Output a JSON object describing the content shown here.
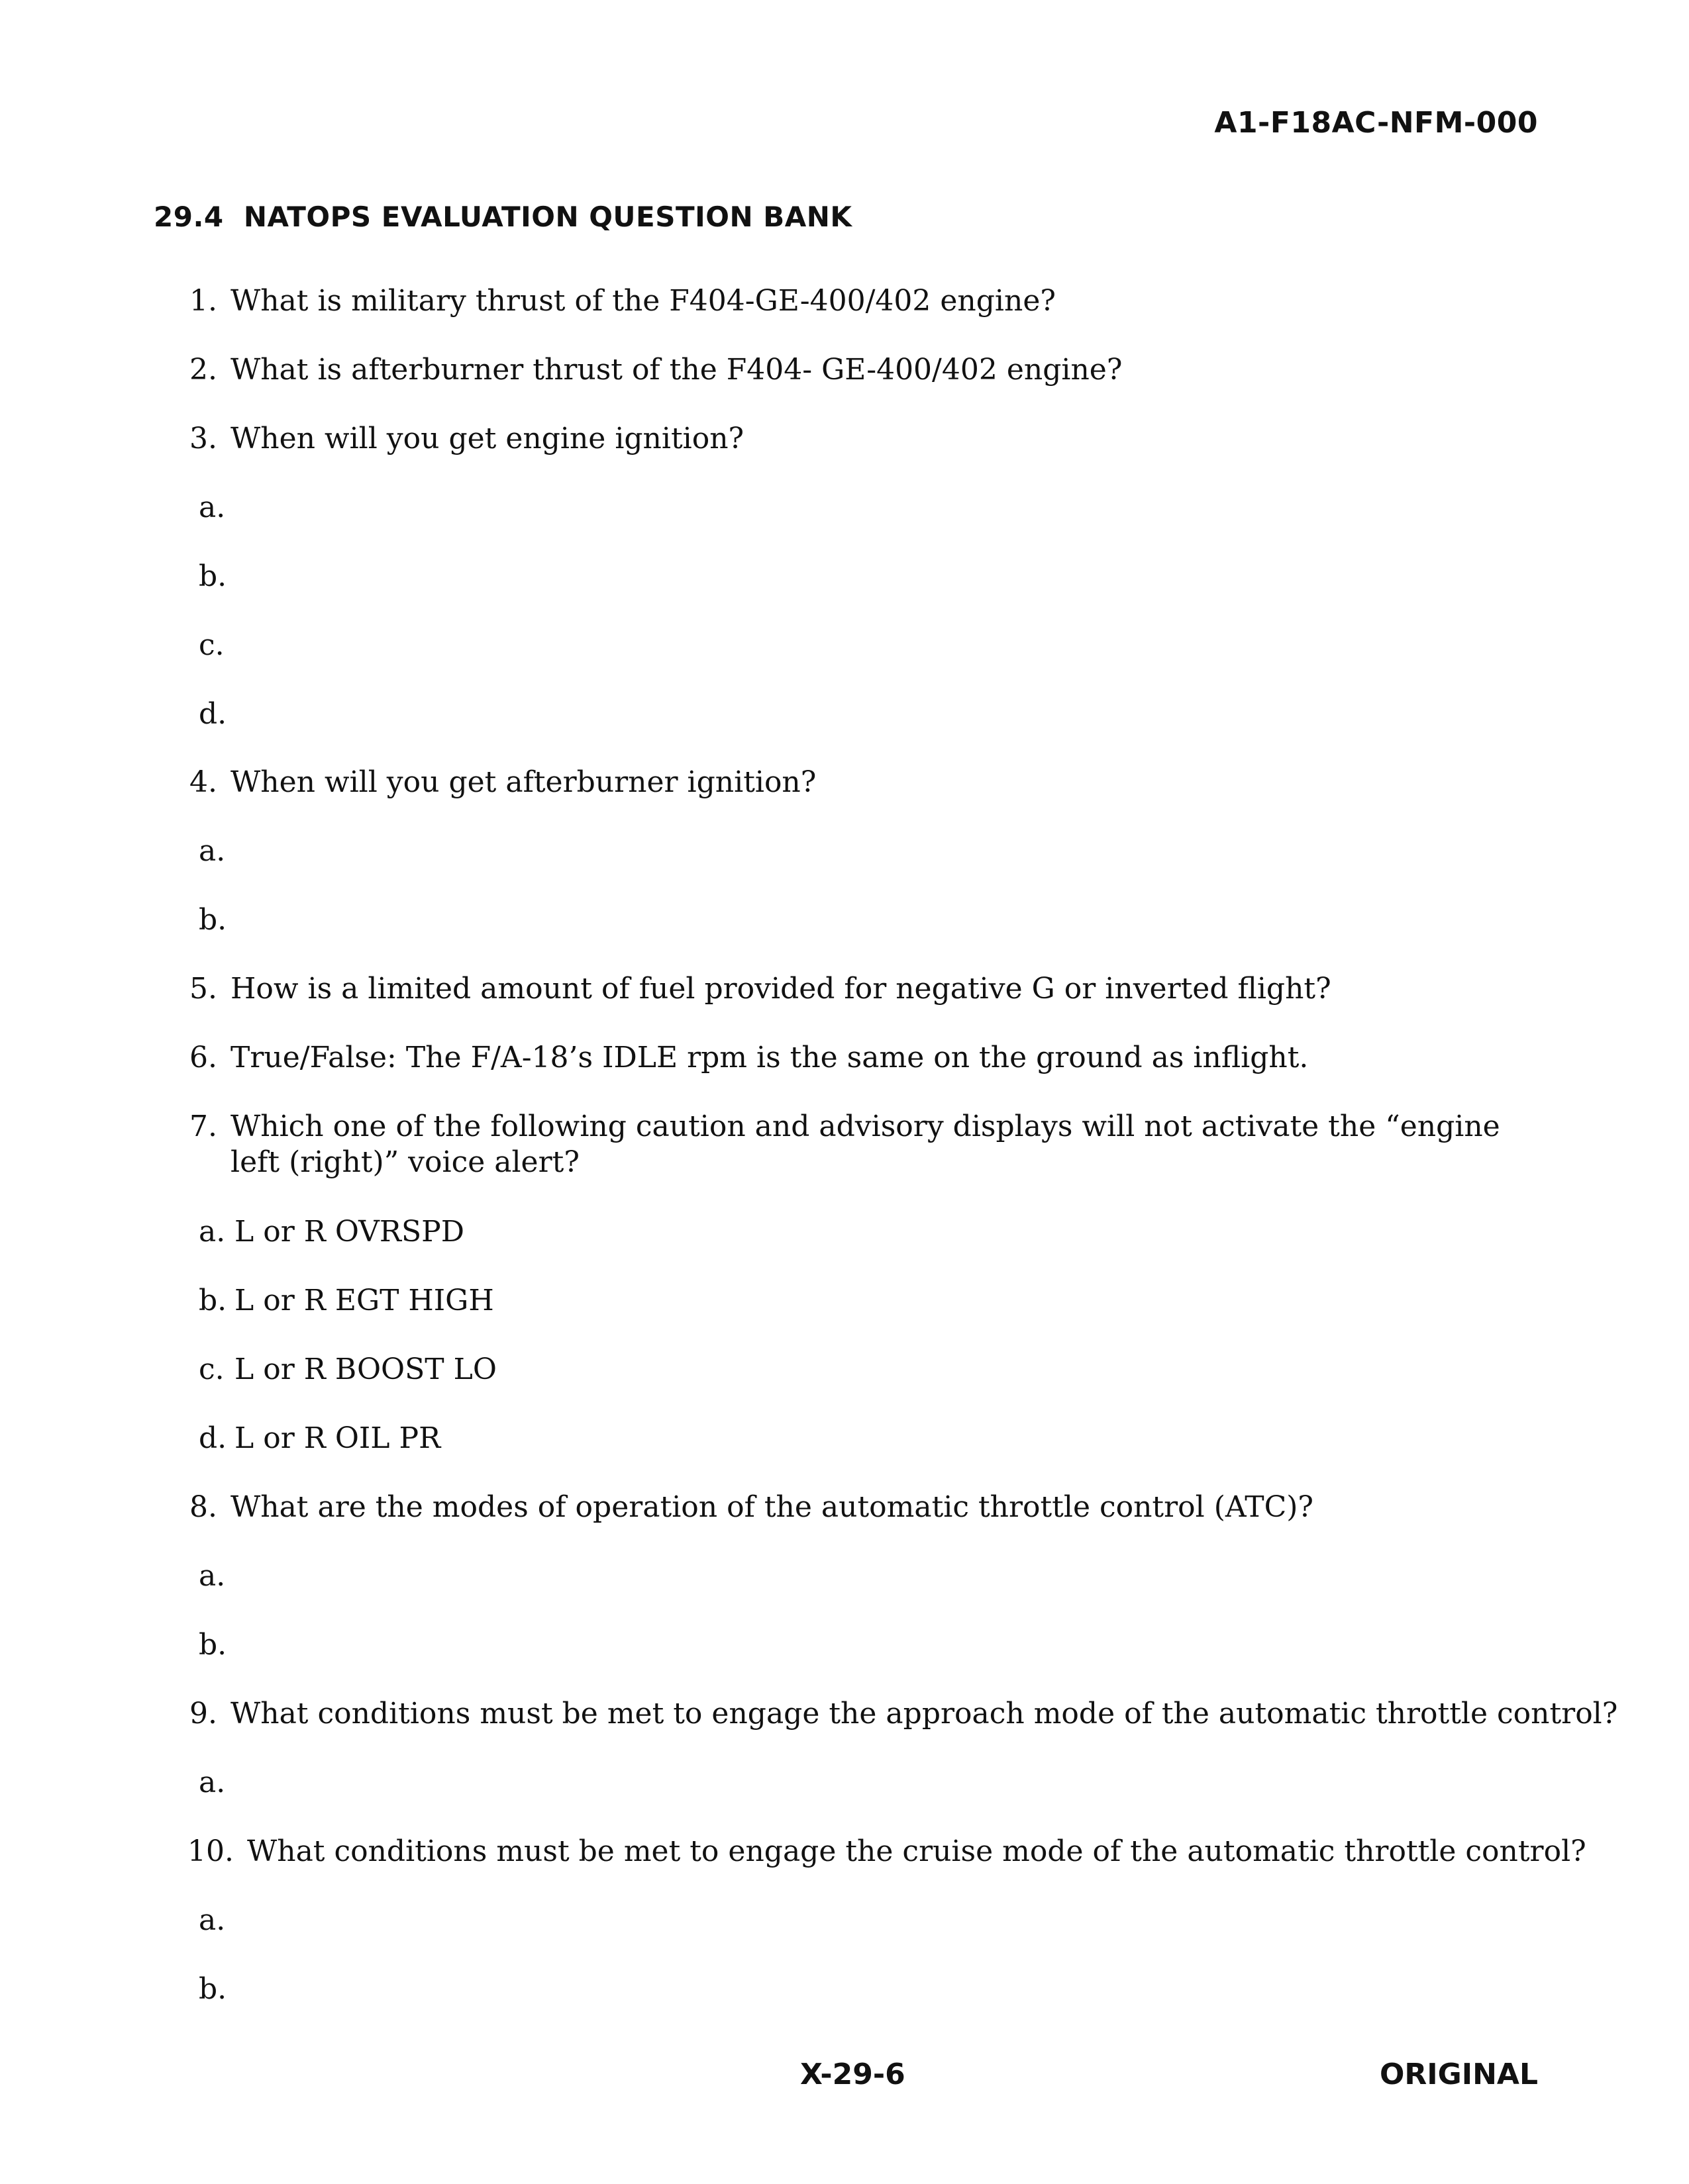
{
  "header": {
    "doc_number": "A1-F18AC-NFM-000"
  },
  "section": {
    "number": "29.4",
    "title": "NATOPS EVALUATION QUESTION BANK"
  },
  "questions": [
    {
      "num": "1.",
      "text": "What is military thrust of the F404-GE-400/402 engine?"
    },
    {
      "num": "2.",
      "text": "What is afterburner thrust of the F404- GE-400/402 engine?"
    },
    {
      "num": "3.",
      "text": "When will you get engine ignition?",
      "subs": [
        {
          "letter": "a.",
          "text": ""
        },
        {
          "letter": "b.",
          "text": ""
        },
        {
          "letter": "c.",
          "text": ""
        },
        {
          "letter": "d.",
          "text": ""
        }
      ]
    },
    {
      "num": "4.",
      "text": "When will you get afterburner ignition?",
      "subs": [
        {
          "letter": "a.",
          "text": ""
        },
        {
          "letter": "b.",
          "text": ""
        }
      ]
    },
    {
      "num": "5.",
      "text": "How is a limited amount of fuel provided for negative G or inverted flight?"
    },
    {
      "num": "6.",
      "text": "True/False: The F/A-18’s IDLE rpm is the same on the ground as inflight."
    },
    {
      "num": "7.",
      "text": "Which one of the following caution and advisory displays will not activate the “engine left (right)” voice alert?",
      "subs": [
        {
          "letter": "a.",
          "text": "L or R OVRSPD"
        },
        {
          "letter": "b.",
          "text": "L or R EGT HIGH"
        },
        {
          "letter": "c.",
          "text": "L or R BOOST LO"
        },
        {
          "letter": "d.",
          "text": "L or R OIL PR"
        }
      ]
    },
    {
      "num": "8.",
      "text": "What are the modes of operation of the automatic throttle control (ATC)?",
      "subs": [
        {
          "letter": "a.",
          "text": ""
        },
        {
          "letter": "b.",
          "text": ""
        }
      ]
    },
    {
      "num": "9.",
      "text": "What conditions must be met to engage the approach mode of the automatic throttle control?",
      "subs": [
        {
          "letter": "a.",
          "text": ""
        }
      ]
    },
    {
      "num": "10.",
      "text": "What conditions must be met to engage the cruise mode of the automatic throttle control?",
      "subs": [
        {
          "letter": "a.",
          "text": ""
        },
        {
          "letter": "b.",
          "text": ""
        }
      ]
    }
  ],
  "footer": {
    "page_number": "X-29-6",
    "status": "ORIGINAL"
  }
}
